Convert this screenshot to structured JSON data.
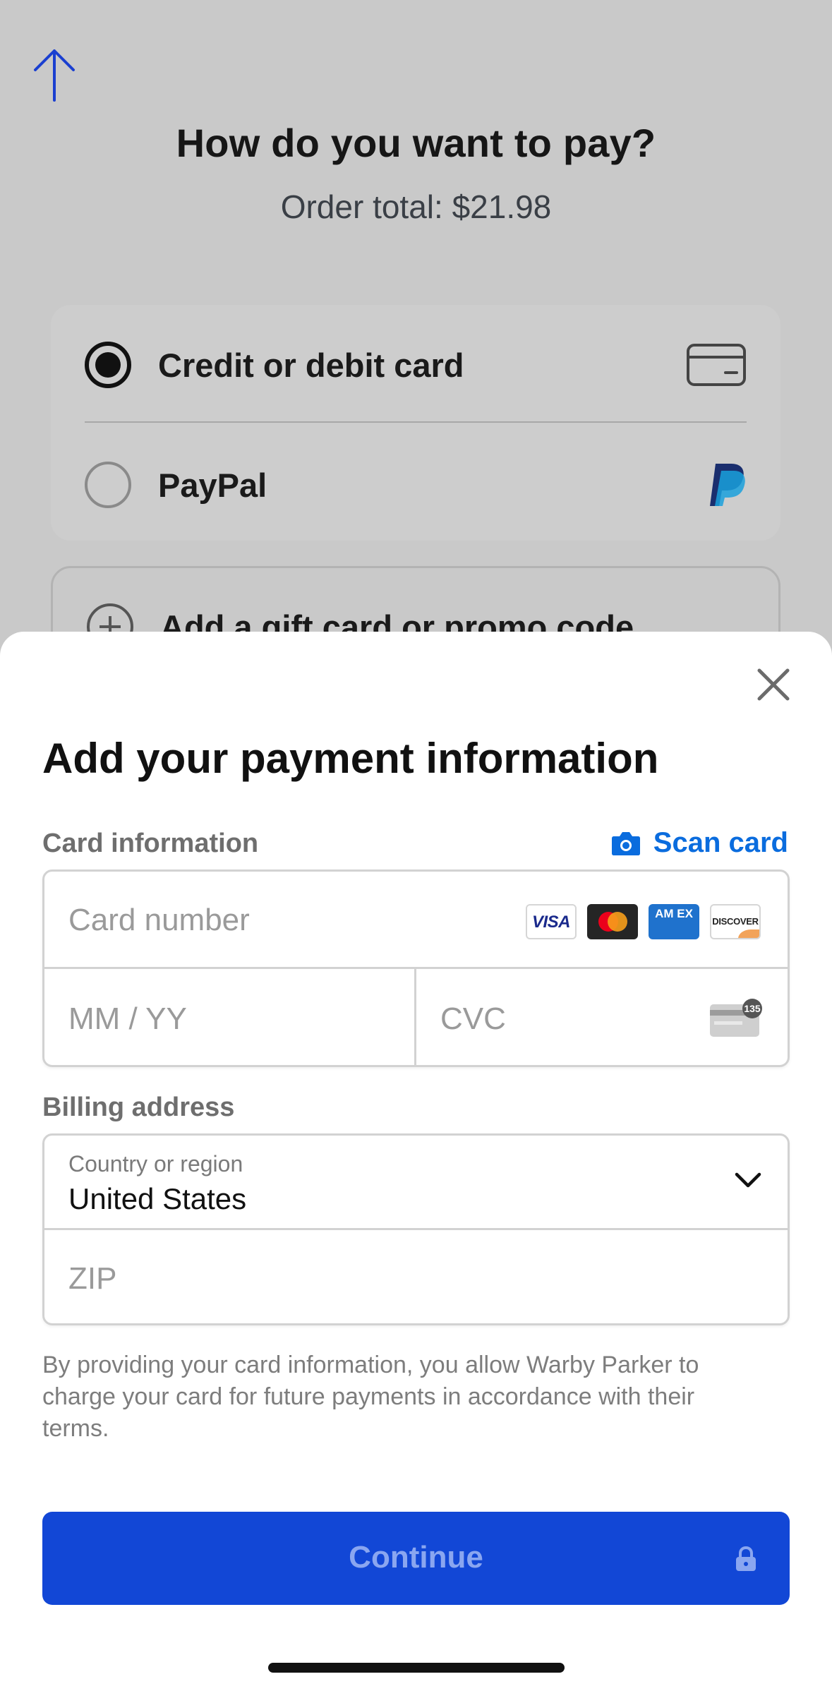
{
  "background": {
    "title": "How do you want to pay?",
    "order_total": "Order total: $21.98",
    "methods": [
      {
        "label": "Credit or debit card",
        "selected": true,
        "icon": "credit-card-icon"
      },
      {
        "label": "PayPal",
        "selected": false,
        "icon": "paypal-icon"
      }
    ],
    "gift_card_label": "Add a gift card or promo code"
  },
  "sheet": {
    "title": "Add your payment information",
    "card_section_label": "Card information",
    "scan_card_label": "Scan card",
    "card_number_placeholder": "Card number",
    "card_brands": {
      "visa": "VISA",
      "amex": "AM EX",
      "discover": "DISCOVER"
    },
    "expiry_placeholder": "MM / YY",
    "cvc_placeholder": "CVC",
    "cvc_badge": "135",
    "billing_section_label": "Billing address",
    "country_caption": "Country or region",
    "country_value": "United States",
    "zip_placeholder": "ZIP",
    "legal_text": "By providing your card information, you allow Warby Parker to charge your card for future payments in accordance with their terms.",
    "continue_label": "Continue"
  },
  "colors": {
    "primary_button": "#1247d6",
    "link_blue": "#0a6cde",
    "overlay_gray": "#c9c9c9"
  }
}
